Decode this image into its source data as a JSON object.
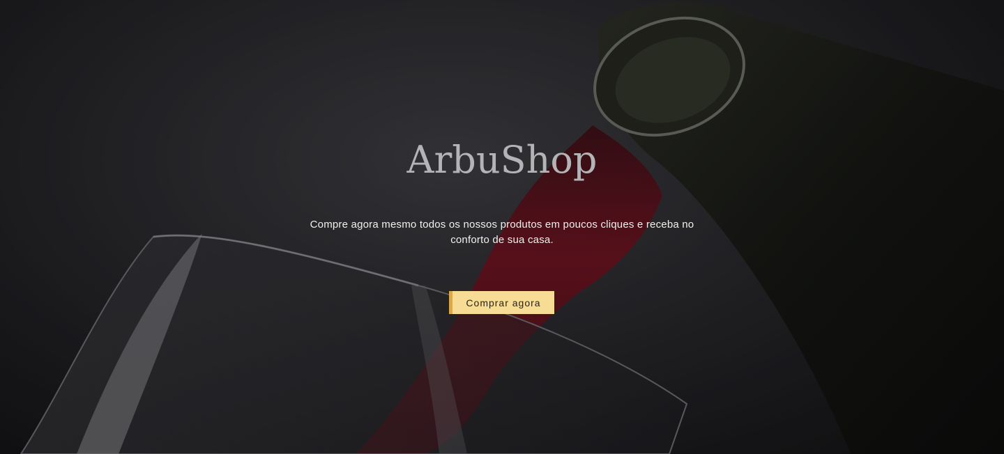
{
  "hero": {
    "title": "ArbuShop",
    "text": "Compre agora mesmo todos os nossos produtos em poucos cliques e receba no conforto de sua casa.",
    "cta_label": "Comprar agora"
  },
  "colors": {
    "background": "#141416",
    "title": "#b4b4b6",
    "text": "#f2f0ec",
    "button_bg": "#f7dc96",
    "button_accent": "#d9a94a",
    "wine": "#6e0f1c"
  }
}
